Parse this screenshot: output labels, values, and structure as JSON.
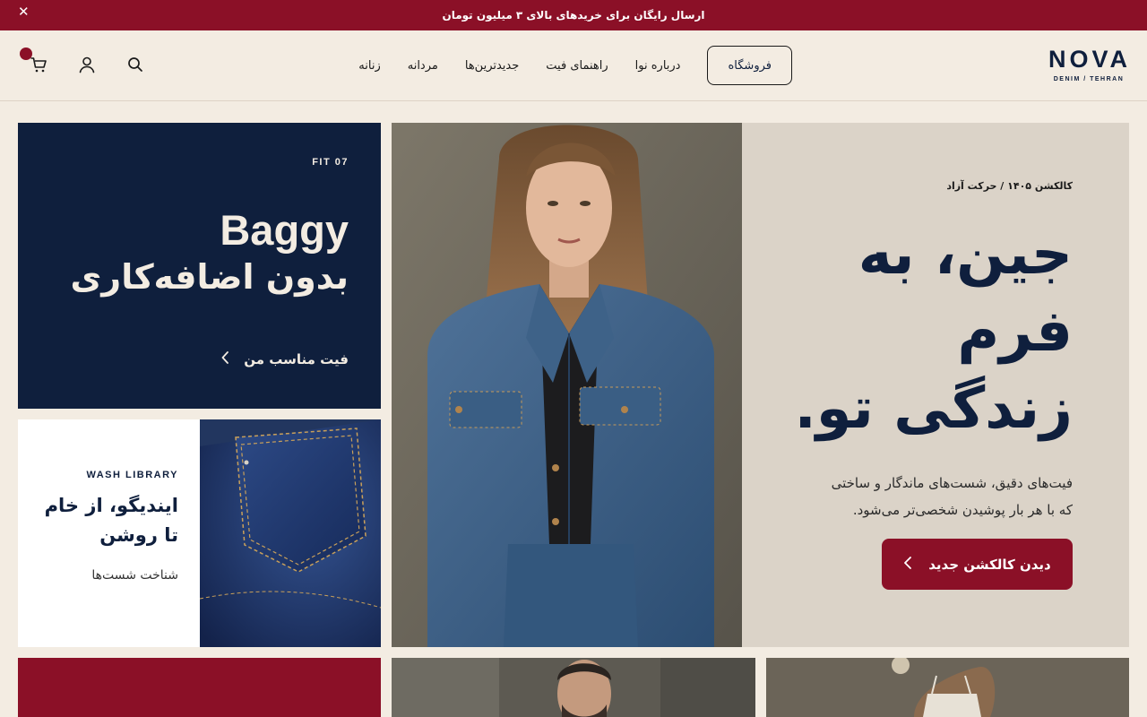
{
  "announcement": {
    "text": "ارسال رایگان برای خریدهای بالای ۳ میلیون تومان",
    "close": "✕"
  },
  "logo": {
    "name": "NOVA",
    "sub": "DENIM / TEHRAN"
  },
  "nav": {
    "women": "زنانه",
    "men": "مردانه",
    "new": "جدیدترین‌ها",
    "fit_guide": "راهنمای فیت",
    "about": "درباره نوا",
    "shop": "فروشگاه"
  },
  "icons": {
    "search": "search-icon",
    "account": "user-icon",
    "cart": "cart-icon"
  },
  "hero": {
    "eyebrow": "کالکشن ۱۴۰۵ / حرکت آزاد",
    "headline_1": "جین، به",
    "headline_2": "فرم",
    "headline_3": "زندگی تو.",
    "sub_1": "فیت‌های دقیق، شست‌های ماندگار و ساختی",
    "sub_2": "که با هر بار پوشیدن شخصی‌تر می‌شود.",
    "cta": "دیدن کالکشن جدید"
  },
  "fit_card": {
    "tag": "FIT 07",
    "title_en": "Baggy",
    "title_fa": "بدون اضافه‌کاری",
    "link": "فیت مناسب من"
  },
  "wash_card": {
    "tag": "WASH LIBRARY",
    "title": "ایندیگو، از خام تا روشن",
    "link": "شناخت شست‌ها"
  },
  "colors": {
    "accent": "#8b1027",
    "navy": "#0f1f3d",
    "cream": "#f3ece2",
    "sand": "#dbd3c8"
  }
}
